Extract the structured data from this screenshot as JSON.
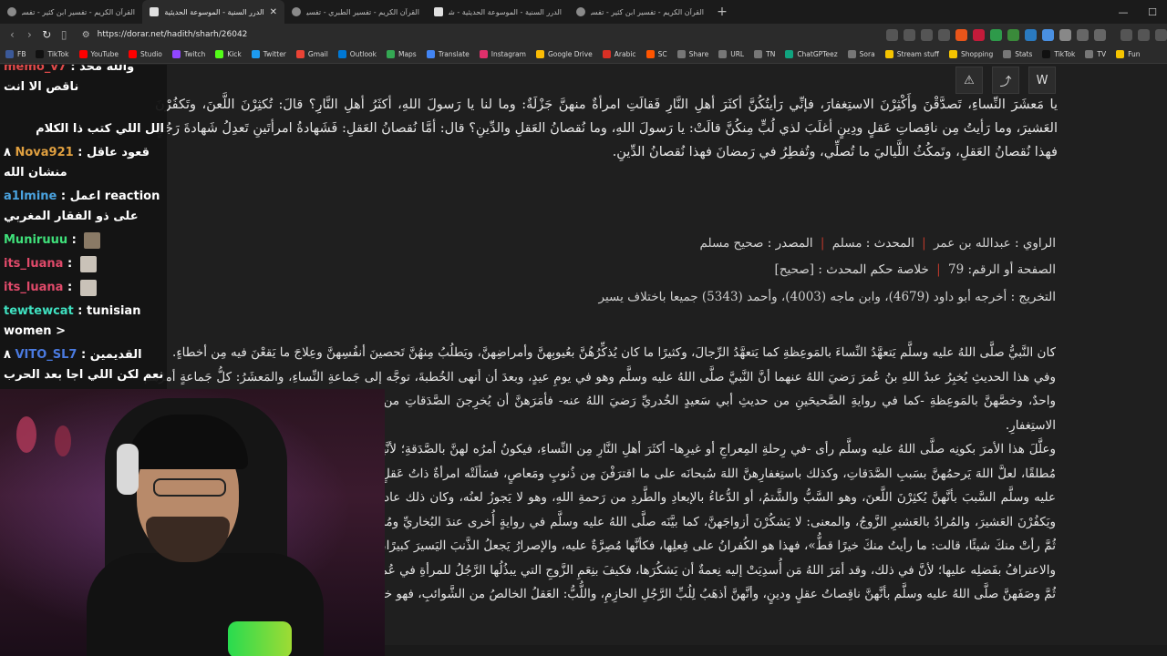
{
  "browser": {
    "tabs": [
      {
        "title": "القرآن الكريم - تفسير ابن كثير - تفسير",
        "active": false
      },
      {
        "title": "الدرر السنية - الموسوعة الحديثية",
        "active": true
      },
      {
        "title": "القرآن الكريم - تفسير الطبري - تفسير",
        "active": false
      },
      {
        "title": "الدرر السنية - الموسوعة الحديثية - شر",
        "active": false
      },
      {
        "title": "القرآن الكريم - تفسير ابن كثير - تفسير",
        "active": false
      }
    ],
    "url": "https://dorar.net/hadith/sharh/26042",
    "bookmarks": [
      "FB",
      "TikTok",
      "YouTube",
      "Studio",
      "Twitch",
      "Kick",
      "Twitter",
      "Gmail",
      "Outlook",
      "Maps",
      "Translate",
      "Instagram",
      "Google Drive",
      "Arabic",
      "SC",
      "Share",
      "URL",
      "TN",
      "ChatGPTeez",
      "Sora",
      "Stream stuff",
      "Shopping",
      "Stats",
      "TikTok",
      "TV",
      "Fun"
    ],
    "bookmark_colors": [
      "#3b5998",
      "#111111",
      "#ff0000",
      "#ff0000",
      "#9146ff",
      "#53fc18",
      "#1d9bf0",
      "#ea4335",
      "#0078d4",
      "#34a853",
      "#4285f4",
      "#e1306c",
      "#fbbc04",
      "#d93025",
      "#ff5500",
      "#777777",
      "#777777",
      "#777777",
      "#10a37f",
      "#777777",
      "#f5c400",
      "#f5c400",
      "#777777",
      "#111111",
      "#777777",
      "#f5c400"
    ]
  },
  "page": {
    "tool_icons": [
      "⚠",
      "⤴",
      "W"
    ],
    "hadith_text": "يا مَعشَرَ النِّساءِ، تَصدَّقْنَ وأَكْثِرْنَ الاستِغفارَ، فإنِّي رَأيتُكُنَّ أكثَرَ أهلِ النَّارِ فَقالَتِ امرأةٌ منهنَّ جَزْلَةٌ: وما لنا يا رَسولَ اللهِ، أكثَرُ أهلِ النَّارِ؟ قالَ: تُكثِرْنَ اللَّعنَ، وتَكفُرْنَ العَشيرَ، وما رَأيتُ مِن ناقِصاتِ عَقلٍ ودِينٍ أغلَبَ لذي لُبٍّ مِنكُنَّ قالَتْ: يا رَسولَ اللهِ، وما نُقصانُ العَقلِ والدِّينِ؟ قال: أمَّا نُقصانُ العَقلِ: فَشَهادةُ امرأتَينِ تَعدِلُ شَهادةَ رَجُلٍ فهذا نُقصانُ العَقلِ، وتَمكُثُ اللَّياليَ ما تُصلِّي، وتُفطِرُ في رَمضانَ فهذا نُقصانُ الدِّينِ.",
    "narrator_label": "الراوي :",
    "narrator": "عبدالله بن عمر",
    "muhaddith_label": "المحدث :",
    "muhaddith": "مسلم",
    "source_label": "المصدر :",
    "source": "صحيح مسلم",
    "page_label": "الصفحة أو الرقم:",
    "page_num": "79",
    "ruling_label": "خلاصة حكم المحدث :",
    "ruling": "[صحيح]",
    "takhrij_label": "التخريج :",
    "takhrij": "أخرجه أبو داود (4679)، وابن ماجه (4003)، وأحمد (5343) جميعا باختلاف يسير",
    "sharh": [
      "كان النَّبيُّ صلَّى اللهُ عليه وسلَّم يَتعهَّدُ النِّساءَ بالمَوعِظةِ كما يَتعهَّدُ الرِّجالَ، وكثيرًا ما كان يُذكِّرُهُنَّ بعُيوبِهنَّ وأمراضِهنَّ، ويَطلُبُ مِنهُنَّ تَحصينَ أنفُسِهنَّ وعِلاجَ ما يَقعْنَ فيه مِن أخطاءٍ.",
      "وفي هذا الحديثِ يُخبِرُ عبدُ اللهِ بنُ عُمرَ رَضيَ اللهُ عنهما أنَّ النَّبيَّ صلَّى اللهُ عليه وسلَّم وهو في يومِ عيدٍ، وبعدَ أن أنهى الخُطبةَ، توجَّه إلى جَماعةِ النِّساءِ، والمَعشَرُ: كلُّ جَماعةٍ أمرُهم واحدٌ، وخصَّهنَّ بالمَوعِظةِ -كما في روايةِ الصَّحيحَينِ من حديثِ أبي سَعيدٍ الخُدريِّ رَضيَ اللهُ عنه- فأمَرَهنَّ أن يُخرِجنَ الصَّدَقاتِ من أموالِهنَّ، وأمَرَهنَّ صلَّى اللهُ عليه وسلَّم بكَثرةِ الاستِغفارِ.",
      "وعلَّلَ هذا الأمرَ بكونِه صلَّى اللهُ عليه وسلَّم رأى -في رِحلةِ المِعراجِ أو غيرِها- أكثَرَ أهلِ النَّارِ مِن النِّساءِ، فيكونُ أمرُه لهنَّ بالصَّدَقةِ؛ لأنَّها تُنجِّي مِن النَّارِ، يُخلِّصْنَ مِن النَّارِ، وهو الصَّدَقةُ مُطلقًا، لعلَّ اللهَ يَرحمُهنَّ بسَببِ الصَّدَقاتِ، وكذلك باستِغفارِهنَّ اللهَ سُبحانَه على ما اقترَفْنَ مِن ذُنوبٍ ومَعاصٍ، فسَألَتْه امرأةٌ ذاتُ عَقلٍ ورأيٍ، بِمَ استحقَقْنا ذلك؟ فبيَّنَ النَّبيُّ صلَّى اللهُ عليه وسلَّم السَّببَ بأنَّهنَّ يُكثِرْنَ اللَّعنَ، وهو السَّبُّ والشَّتمُ، أو الدُّعاءُ بالإبعادِ والطَّردِ من رَحمةِ اللهِ، وهو لا يَجوزُ لعنُه، وكان ذلك عادةً جاريةً في نِساءِ العَرَبِ، فحذَّرَهنَّ منه ليَترُكْنَه، ويَكفُرْنَ العَشيرَ، والمُرادُ بالعَشيرِ الزَّوجُ، والمعنى: لا يَشكُرْنَ أزواجَهنَّ، كما بيَّنَه صلَّى اللهُ عليه وسلَّم في روايةٍ أُخرى عندَ البُخاريِّ ومُسلمٍ بقولِه: «لو أحسَنْتَ إلى إحداهُنَّ الدَّهرَ كلَّه، ثُمَّ رأتْ منكَ شيئًا، قالت: ما رأيتُ منكَ خيرًا قطُّ»، فهذا هو الكُفرانُ على فِعلِها، فكأنَّها مُصِرَّةٌ عليه، والإصرارُ يَجعلُ الذَّنبَ اليَسيرَ كبيرًا، وذلك أنَّ حقَّ الزَّوجِ عظيمٌ، فيَجِبُ عليها شُكرُه، والاعترافُ بفَضلِه عليها؛ لأنَّ في ذلك، وقد أمَرَ اللهُ مَن أُسدِيَتْ إليه نِعمةٌ أن يَشكُرَها، فكيفَ بنِعَمِ الزَّوجِ التي يبذُلُها الرَّجُلُ للمرأةِ في عُمرِها كلِّه؟!",
      "ثُمَّ وصَفَهنَّ صلَّى اللهُ عليه وسلَّم بأنَّهنَّ ناقِصاتُ عقلٍ ودينٍ، وأنَّهنَّ أذهَبُ لِلُبِّ الرَّجُلِ الحازِمِ، واللُّبُّ: العَقلُ الخالصُ من الشَّوائبِ، فهو خالصُ ما في الإنسانِ."
    ]
  },
  "chat": {
    "messages": [
      {
        "user": "memo_v7",
        "user_color": "#e04a4a",
        "text": "والله محد ناقص الا انت"
      },
      {
        "user": "",
        "user_color": "#ffffff",
        "text": "الل اللي كتب ذا الكلام"
      },
      {
        "user": "Nova921",
        "user_color": "#e0a040",
        "prefix": "٨",
        "text": "قعود عاقل منشان الله",
        "emote": false
      },
      {
        "user": "a1lmine",
        "user_color": "#4aa3e0",
        "text": "اعمل reaction على ذو الفقار المغربي"
      },
      {
        "user": "Muniruuu",
        "user_color": "#3fe07a",
        "text": "",
        "emote": "face"
      },
      {
        "user": "its_luana",
        "user_color": "#e04a6a",
        "text": "",
        "emote": "cat"
      },
      {
        "user": "its_luana",
        "user_color": "#e04a6a",
        "text": "",
        "emote": "cat"
      },
      {
        "user": "tewtewcat",
        "user_color": "#3fe0c0",
        "text": "tunisian women >"
      },
      {
        "user": "VITO_SL7",
        "user_color": "#4a7ae0",
        "prefix": "٨",
        "text": "القديمين نعم لكن اللي اجا بعد الحرب نووو"
      }
    ]
  }
}
